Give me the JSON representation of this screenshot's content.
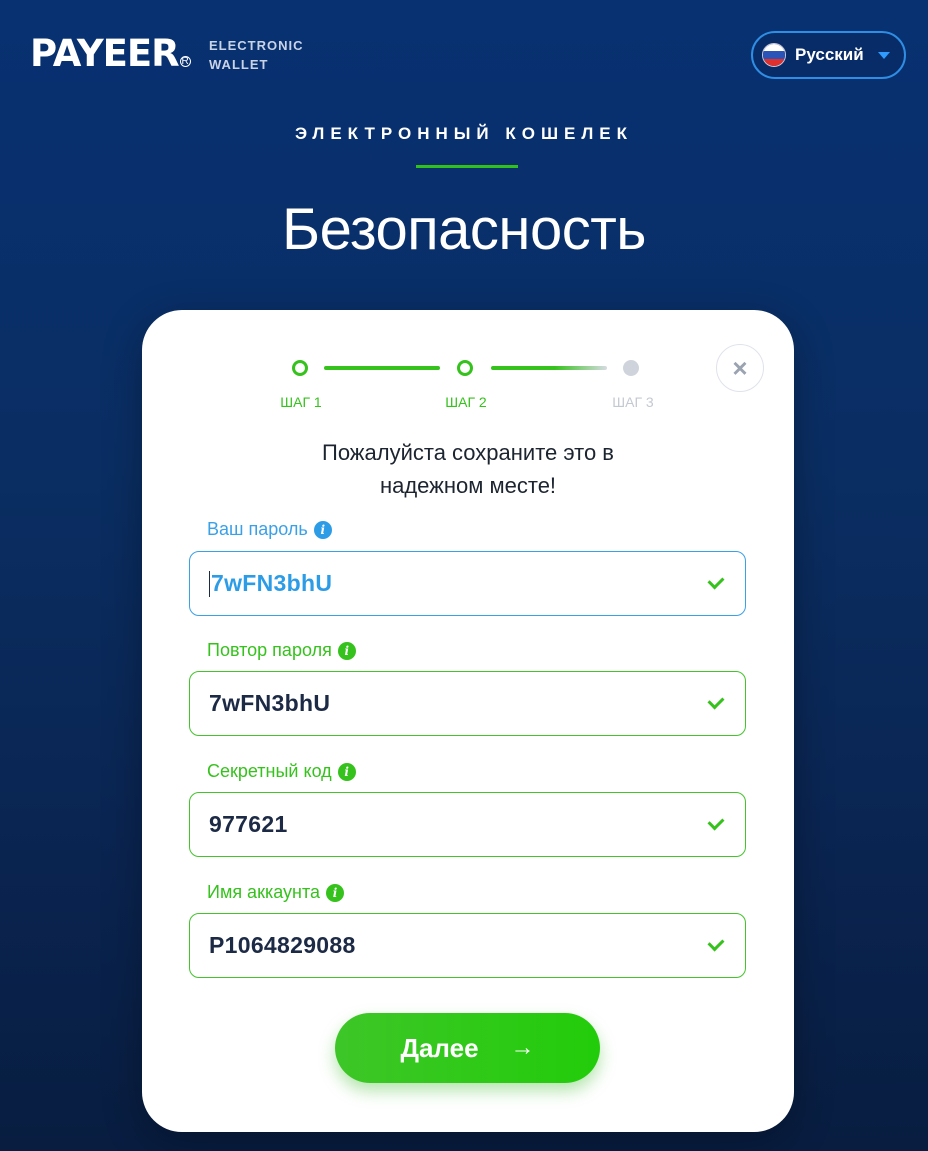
{
  "brand": {
    "logo": "PAYEER",
    "registered": "R",
    "tagline_line1": "ELECTRONIC",
    "tagline_line2": "WALLET"
  },
  "language": {
    "selected": "Русский",
    "flag_icon": "russia-flag-icon",
    "caret_icon": "chevron-down-icon"
  },
  "header": {
    "eyebrow": "ЭЛЕКТРОННЫЙ КОШЕЛЕК",
    "title": "Безопасность"
  },
  "steps": [
    {
      "label": "ШАГ 1",
      "state": "done"
    },
    {
      "label": "ШАГ 2",
      "state": "done"
    },
    {
      "label": "ШАГ 3",
      "state": "todo"
    }
  ],
  "card": {
    "close_icon": "close-icon",
    "close_glyph": "×",
    "instruction_line1": "Пожалуйста сохраните это в",
    "instruction_line2": "надежном месте!"
  },
  "fields": {
    "password": {
      "label": "Ваш пароль",
      "value": "7wFN3bhU",
      "info": "i"
    },
    "password_repeat": {
      "label": "Повтор пароля",
      "value": "7wFN3bhU",
      "info": "i"
    },
    "secret_code": {
      "label": "Секретный код",
      "value": "977621",
      "info": "i"
    },
    "account_name": {
      "label": "Имя аккаунта",
      "value": "P1064829088",
      "info": "i"
    }
  },
  "actions": {
    "next_label": "Далее",
    "next_arrow": "→"
  },
  "colors": {
    "background": "#0a2e63",
    "accent_green": "#36c21d",
    "accent_blue": "#2d9ce6"
  }
}
